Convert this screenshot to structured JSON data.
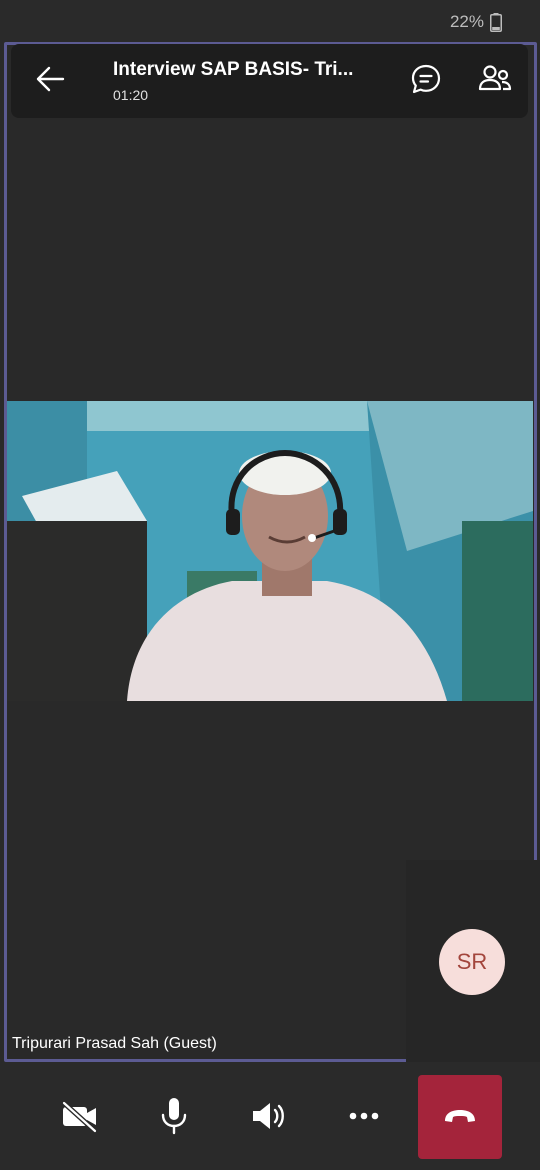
{
  "status_bar": {
    "battery": "22%"
  },
  "call": {
    "title": "Interview SAP BASIS- Tri...",
    "timer": "01:20"
  },
  "participant": {
    "name": "Tripurari Prasad Sah (Guest)"
  },
  "self_view": {
    "initials": "SR"
  },
  "icons": {
    "back": "arrow-left-icon",
    "chat": "chat-bubble-icon",
    "people": "people-icon",
    "camera": "video-off-icon",
    "mic": "microphone-icon",
    "speaker": "speaker-icon",
    "more": "more-horizontal-icon",
    "hangup": "phone-hangup-icon"
  },
  "colors": {
    "stage_border": "#5c5b93",
    "hangup": "#a4243b",
    "avatar_bg": "#f7dedb",
    "avatar_text": "#a3453c"
  }
}
